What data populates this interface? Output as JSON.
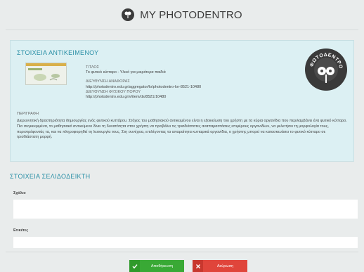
{
  "header": {
    "title": "MY PHOTODENTRO",
    "logo_icon": "photodentro-logo"
  },
  "object": {
    "section_title": "ΣΤΟΙΧΕΙΑ ΑΝΤΙΚΕΙΜΕΝΟΥ",
    "title_label": "ΤΙΤΛΟΣ",
    "title_value": "Το φυτικό κύτταρο - Υλικό για μικρότερα παιδιά",
    "ref_label": "ΔΙΕΥΘΥΝΣΗ ΑΝΑΦΟΡΑΣ",
    "ref_value": "http://photodentro.edu.gr/aggregator/lo/photodentro-lor-8521-10480",
    "phys_label": "ΔΙΕΥΘΥΝΣΗ ΦΥΣΙΚΟΥ ΠΟΡΟΥ",
    "phys_value": "http://photodentro.edu.gr/v/item/ds/8521/10480",
    "desc_label": "ΠΕΡΙΓΡΑΦΗ",
    "description": "Διερευνητική δραστηριότητα δημιουργίας ενός φυτικού κυττάρου. Στόχος του μαθησιακού αντικειμένου είναι η εξοικείωση του χρήστη με τα κύρια οργανίδια που περιλαμβάνει ένα φυτικό κύτταρο. Πιο συγκεκριμένα, το μαθησιακό αντικείμενο δίνει τη δυνατότητα στον χρήστη να προβάλει τις τρισδιάστατες αναπαραστάσεις επιμέρους οργανιδίων, να μελετήσει τη μορφολογία τους, περιστρέφοντάς τα, και να πληροφορηθεί τη λειτουργία τους. Στη συνέχεια, επιλέγοντας τα απαραίτητα κυτταρικά οργανίδια, ο χρήστης μπορεί να κατασκευάσει το φυτικό κύτταρο σε τρισδιάστατη μορφή.",
    "stamp_text": "ΦΩΤΟΔΕΝΤΡΟ"
  },
  "bookmark": {
    "section_title": "ΣΤΟΙΧΕΙΑ ΣΕΛΙΔΟΔΕΙΚΤΗ",
    "comment_label": "Σχόλιο",
    "comment_value": "",
    "tags_label": "Ετικέτες",
    "tags_value": ""
  },
  "actions": {
    "save_label": "Αποθήκευση",
    "cancel_label": "Ακύρωση"
  },
  "colors": {
    "accent": "#2a8fa6",
    "panel": "#dcf0f3",
    "save": "#39a935",
    "cancel": "#e0453b"
  }
}
